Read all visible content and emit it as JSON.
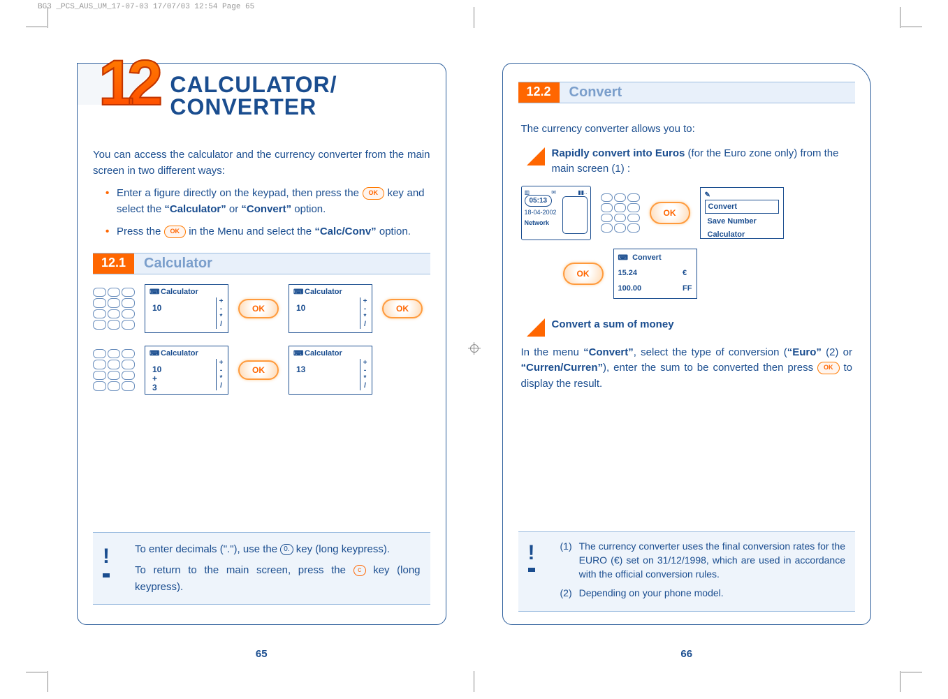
{
  "header": "BG3 _PCS_AUS_UM_17-07-03  17/07/03  12:54  Page 65",
  "left": {
    "chapter_number": "12",
    "chapter_title_l1": "CALCULATOR/",
    "chapter_title_l2": "CONVERTER",
    "intro": "You can access the calculator and the currency converter from the main screen in two different ways:",
    "bullet1_a": "Enter a figure directly on the keypad, then press the ",
    "bullet1_b": " key and select the ",
    "bullet1_c": " or ",
    "bullet1_d": " option.",
    "bullet1_q1": "“Calculator”",
    "bullet1_q2": "“Convert”",
    "bullet2_a": "Press the ",
    "bullet2_b": " in the Menu and select the ",
    "bullet2_c": " option.",
    "bullet2_q1": "“Calc/Conv”",
    "sec1_num": "12.1",
    "sec1_title": "Calculator",
    "ok_label": "OK",
    "scr_calc_title": "Calculator",
    "scr_a_val": "10",
    "scr_b_val": "10",
    "scr_c_val": "10\n+\n3",
    "scr_d_val": "13",
    "note1_a": "To enter decimals (\".\"), use the ",
    "note1_key": "0.",
    "note1_b": " key (long keypress).",
    "note2_a": "To return to the main screen, press the ",
    "note2_key": "c",
    "note2_b": " key (long keypress).",
    "page_num": "65"
  },
  "right": {
    "sec2_num": "12.2",
    "sec2_title": "Convert",
    "intro": "The currency converter allows you to:",
    "tri1_a": "Rapidly convert into Euros ",
    "tri1_b": "(for the Euro zone only) from the main screen (1) :",
    "home_time": "05:13",
    "home_date": "18-04-2002",
    "home_net": "Network",
    "ok_label": "OK",
    "menu_edit_icon": "✎",
    "menu_opt1": "Convert",
    "menu_opt2": "Save Number",
    "menu_opt3": "Calculator",
    "conv_title": "Convert",
    "conv_v1": "15.24",
    "conv_u1": "€",
    "conv_v2": "100.00",
    "conv_u2": "FF",
    "tri2": "Convert a sum of money",
    "para_a": "In the menu ",
    "para_q1": "“Convert”",
    "para_b": ", select the type of conversion (",
    "para_q2": "“Euro”",
    "para_c": " (2) or ",
    "para_q3": "“Curren/Curren”",
    "para_d": "), enter the sum to be converted then press ",
    "para_e": " to display the result.",
    "fn1_num": "(1)",
    "fn1_txt": "The currency converter uses the final conversion rates for the EURO (€) set on 31/12/1998, which are used in accordance with the official conversion rules.",
    "fn2_num": "(2)",
    "fn2_txt": "Depending on your phone model.",
    "page_num": "66"
  }
}
